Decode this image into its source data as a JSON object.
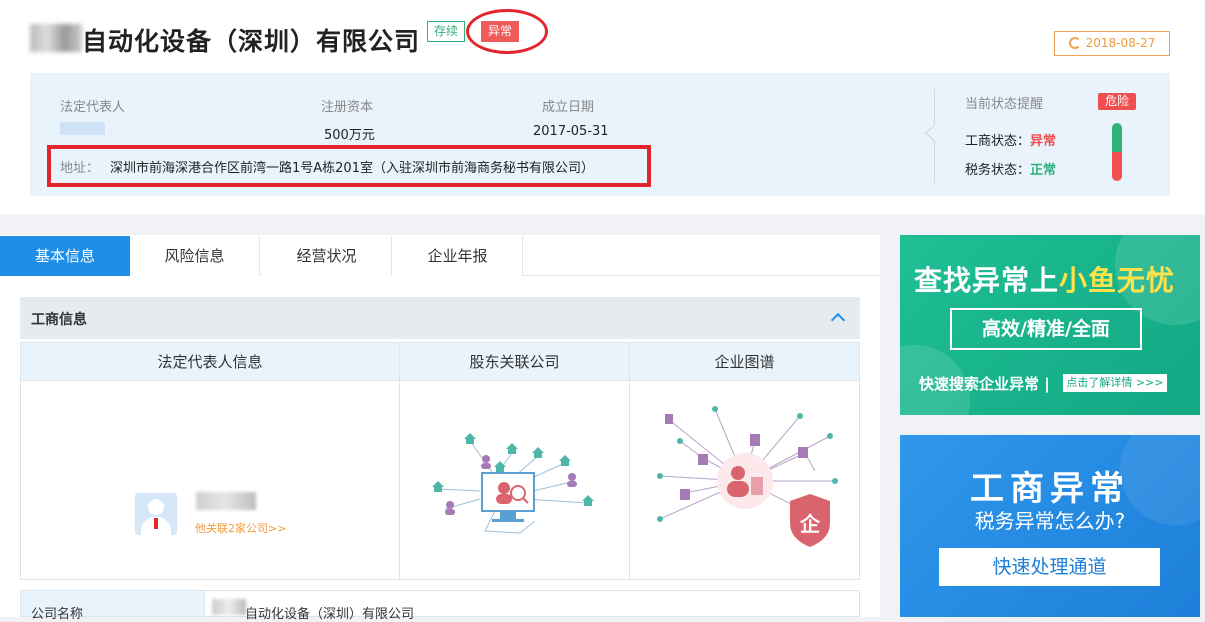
{
  "header": {
    "company_name": "自动化设备（深圳）有限公司",
    "tag_active": "存续",
    "tag_abnormal": "异常",
    "date": "2018-08-27"
  },
  "info": {
    "legal_rep_label": "法定代表人",
    "capital_label": "注册资本",
    "capital_value": "500万元",
    "founded_label": "成立日期",
    "founded_value": "2017-05-31",
    "address_label": "地址：",
    "address_value": "深圳市前海深港合作区前湾一路1号A栋201室（入驻深圳市前海商务秘书有限公司）"
  },
  "status": {
    "title": "当前状态提醒",
    "badge": "危险",
    "gs_label": "工商状态：",
    "gs_value": "异常",
    "tax_label": "税务状态：",
    "tax_value": "正常"
  },
  "tabs": [
    "基本信息",
    "风险信息",
    "经营状况",
    "企业年报"
  ],
  "section": {
    "title": "工商信息",
    "columns": [
      "法定代表人信息",
      "股东关联公司",
      "企业图谱"
    ],
    "related_companies": "他关联2家公司>>",
    "row_label": "公司名称",
    "row_value": "自动化设备（深圳）有限公司"
  },
  "ads": {
    "ad1_title_part1": "查找异常上",
    "ad1_title_part2": "小鱼无忧",
    "ad1_box": "高效/精准/全面",
    "ad1_sub": "快速搜索企业异常 |",
    "ad1_btn": "点击了解详情 >>>",
    "ad2_title": "工商异常",
    "ad2_sub": "税务异常怎么办?",
    "ad2_btn": "快速处理通道"
  },
  "colors": {
    "primary_blue": "#1e8fe8",
    "danger_red": "#ef4f4f",
    "ok_green": "#2fb37a",
    "warn_orange": "#f09a3a"
  }
}
